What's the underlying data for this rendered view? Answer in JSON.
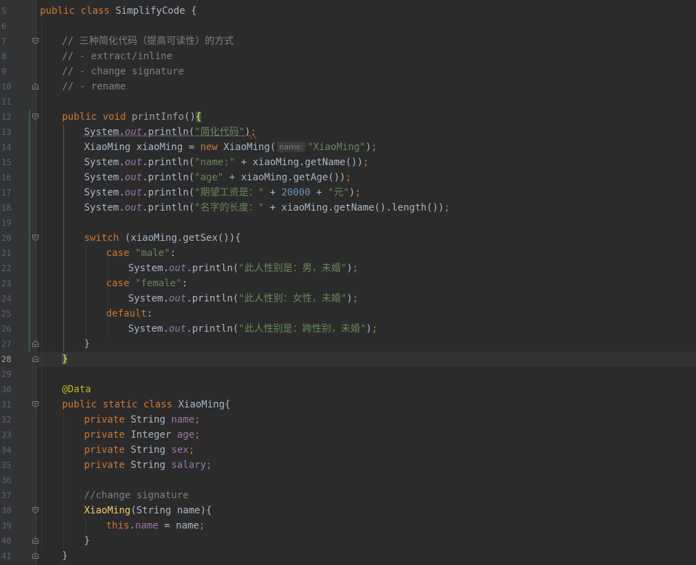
{
  "editor": {
    "lines": [
      {
        "num": "5",
        "fold": "",
        "indent": 0,
        "tokens": [
          [
            "kw",
            "public class "
          ],
          [
            "plain",
            "SimplifyCode {"
          ]
        ]
      },
      {
        "num": "6",
        "fold": "",
        "indent": 0,
        "tokens": []
      },
      {
        "num": "7",
        "fold": "open",
        "indent": 1,
        "tokens": [
          [
            "cmt",
            "// 三种简化代码（提高可读性）的方式"
          ]
        ]
      },
      {
        "num": "8",
        "fold": "",
        "indent": 1,
        "tokens": [
          [
            "cmt",
            "// - extract/inline"
          ]
        ]
      },
      {
        "num": "9",
        "fold": "",
        "indent": 1,
        "tokens": [
          [
            "cmt",
            "// - change signature"
          ]
        ]
      },
      {
        "num": "10",
        "fold": "close",
        "indent": 1,
        "tokens": [
          [
            "cmt",
            "// - rename"
          ]
        ]
      },
      {
        "num": "11",
        "fold": "",
        "indent": 0,
        "tokens": []
      },
      {
        "num": "12",
        "fold": "open",
        "indent": 1,
        "tokens": [
          [
            "kw",
            "public void "
          ],
          [
            "muted",
            "printInfo"
          ],
          [
            "plain",
            "()"
          ],
          [
            "brace",
            "{"
          ]
        ]
      },
      {
        "num": "13",
        "fold": "",
        "indent": 2,
        "tokens": [
          [
            "plain under",
            "System."
          ],
          [
            "stat under",
            "out"
          ],
          [
            "plain under",
            ".println("
          ],
          [
            "str under",
            "\"简化代码\""
          ],
          [
            "plain under",
            ")"
          ],
          [
            "kw wavy",
            ";"
          ]
        ]
      },
      {
        "num": "14",
        "fold": "",
        "indent": 2,
        "tokens": [
          [
            "plain",
            "XiaoMing xiaoMing = "
          ],
          [
            "kw",
            "new "
          ],
          [
            "plain",
            "XiaoMing("
          ],
          [
            "hint",
            "name:"
          ],
          [
            "str",
            "\"XiaoMing\""
          ],
          [
            "plain",
            ")"
          ],
          [
            "kw",
            ";"
          ]
        ]
      },
      {
        "num": "15",
        "fold": "",
        "indent": 2,
        "tokens": [
          [
            "plain",
            "System."
          ],
          [
            "stat",
            "out"
          ],
          [
            "plain",
            ".println("
          ],
          [
            "str",
            "\"name:\""
          ],
          [
            "plain",
            " + xiaoMing.getName())"
          ],
          [
            "kw",
            ";"
          ]
        ]
      },
      {
        "num": "16",
        "fold": "",
        "indent": 2,
        "tokens": [
          [
            "plain",
            "System."
          ],
          [
            "stat",
            "out"
          ],
          [
            "plain",
            ".println("
          ],
          [
            "str",
            "\"age\""
          ],
          [
            "plain",
            " + xiaoMing.getAge())"
          ],
          [
            "kw",
            ";"
          ]
        ]
      },
      {
        "num": "17",
        "fold": "",
        "indent": 2,
        "tokens": [
          [
            "plain",
            "System."
          ],
          [
            "stat",
            "out"
          ],
          [
            "plain",
            ".println("
          ],
          [
            "str",
            "\"期望工资是：\""
          ],
          [
            "plain",
            " + "
          ],
          [
            "num",
            "20000"
          ],
          [
            "plain",
            " + "
          ],
          [
            "str",
            "\"元\""
          ],
          [
            "plain",
            ")"
          ],
          [
            "kw",
            ";"
          ]
        ]
      },
      {
        "num": "18",
        "fold": "",
        "indent": 2,
        "tokens": [
          [
            "plain",
            "System."
          ],
          [
            "stat",
            "out"
          ],
          [
            "plain",
            ".println("
          ],
          [
            "str",
            "\"名字的长度：\""
          ],
          [
            "plain",
            " + xiaoMing.getName().length())"
          ],
          [
            "kw",
            ";"
          ]
        ]
      },
      {
        "num": "19",
        "fold": "",
        "indent": 0,
        "tokens": []
      },
      {
        "num": "20",
        "fold": "open",
        "indent": 2,
        "tokens": [
          [
            "kw",
            "switch "
          ],
          [
            "plain",
            "(xiaoMing.getSex()){"
          ]
        ]
      },
      {
        "num": "21",
        "fold": "",
        "indent": 3,
        "tokens": [
          [
            "kw",
            "case "
          ],
          [
            "str",
            "\"male\""
          ],
          [
            "plain",
            ":"
          ]
        ]
      },
      {
        "num": "22",
        "fold": "",
        "indent": 4,
        "tokens": [
          [
            "plain",
            "System."
          ],
          [
            "stat",
            "out"
          ],
          [
            "plain",
            ".println("
          ],
          [
            "str",
            "\"此人性别是：男，未婚\""
          ],
          [
            "plain",
            ")"
          ],
          [
            "kw",
            ";"
          ]
        ]
      },
      {
        "num": "23",
        "fold": "",
        "indent": 3,
        "tokens": [
          [
            "kw",
            "case "
          ],
          [
            "str",
            "\"female\""
          ],
          [
            "plain",
            ":"
          ]
        ]
      },
      {
        "num": "24",
        "fold": "",
        "indent": 4,
        "tokens": [
          [
            "plain",
            "System."
          ],
          [
            "stat",
            "out"
          ],
          [
            "plain",
            ".println("
          ],
          [
            "str",
            "\"此人性别：女性，未婚\""
          ],
          [
            "plain",
            ")"
          ],
          [
            "kw",
            ";"
          ]
        ]
      },
      {
        "num": "25",
        "fold": "",
        "indent": 3,
        "tokens": [
          [
            "kw",
            "default"
          ],
          [
            "plain",
            ":"
          ]
        ]
      },
      {
        "num": "26",
        "fold": "",
        "indent": 4,
        "tokens": [
          [
            "plain",
            "System."
          ],
          [
            "stat",
            "out"
          ],
          [
            "plain",
            ".println("
          ],
          [
            "str",
            "\"此人性别是：跨性别，未婚\""
          ],
          [
            "plain",
            ")"
          ],
          [
            "kw",
            ";"
          ]
        ]
      },
      {
        "num": "27",
        "fold": "close",
        "indent": 2,
        "tokens": [
          [
            "plain",
            "}"
          ]
        ]
      },
      {
        "num": "28",
        "fold": "close",
        "indent": 1,
        "current": true,
        "tokens": [
          [
            "brace",
            "}"
          ]
        ]
      },
      {
        "num": "29",
        "fold": "",
        "indent": 0,
        "tokens": []
      },
      {
        "num": "30",
        "fold": "",
        "indent": 1,
        "tokens": [
          [
            "ann",
            "@Data"
          ]
        ]
      },
      {
        "num": "31",
        "fold": "open",
        "indent": 1,
        "tokens": [
          [
            "kw",
            "public static class "
          ],
          [
            "plain",
            "XiaoMing{"
          ]
        ]
      },
      {
        "num": "32",
        "fold": "",
        "indent": 2,
        "tokens": [
          [
            "kw",
            "private "
          ],
          [
            "plain",
            "String "
          ],
          [
            "field",
            "name"
          ],
          [
            "kw",
            ";"
          ]
        ]
      },
      {
        "num": "33",
        "fold": "",
        "indent": 2,
        "tokens": [
          [
            "kw",
            "private "
          ],
          [
            "plain",
            "Integer "
          ],
          [
            "field",
            "age"
          ],
          [
            "kw",
            ";"
          ]
        ]
      },
      {
        "num": "34",
        "fold": "",
        "indent": 2,
        "tokens": [
          [
            "kw",
            "private "
          ],
          [
            "plain",
            "String "
          ],
          [
            "field",
            "sex"
          ],
          [
            "kw",
            ";"
          ]
        ]
      },
      {
        "num": "35",
        "fold": "",
        "indent": 2,
        "tokens": [
          [
            "kw",
            "private "
          ],
          [
            "plain",
            "String "
          ],
          [
            "field",
            "salary"
          ],
          [
            "kw",
            ";"
          ]
        ]
      },
      {
        "num": "36",
        "fold": "",
        "indent": 0,
        "tokens": []
      },
      {
        "num": "37",
        "fold": "",
        "indent": 2,
        "tokens": [
          [
            "cmt",
            "//change signature"
          ]
        ]
      },
      {
        "num": "38",
        "fold": "open",
        "indent": 2,
        "tokens": [
          [
            "fn",
            "XiaoMing"
          ],
          [
            "plain",
            "(String name){"
          ]
        ]
      },
      {
        "num": "39",
        "fold": "",
        "indent": 3,
        "tokens": [
          [
            "kw",
            "this"
          ],
          [
            "plain",
            "."
          ],
          [
            "field",
            "name"
          ],
          [
            "plain",
            " = name"
          ],
          [
            "kw",
            ";"
          ]
        ]
      },
      {
        "num": "40",
        "fold": "close",
        "indent": 2,
        "tokens": [
          [
            "plain",
            "}"
          ]
        ]
      },
      {
        "num": "41",
        "fold": "close",
        "indent": 1,
        "tokens": [
          [
            "plain",
            "}"
          ]
        ]
      }
    ]
  }
}
